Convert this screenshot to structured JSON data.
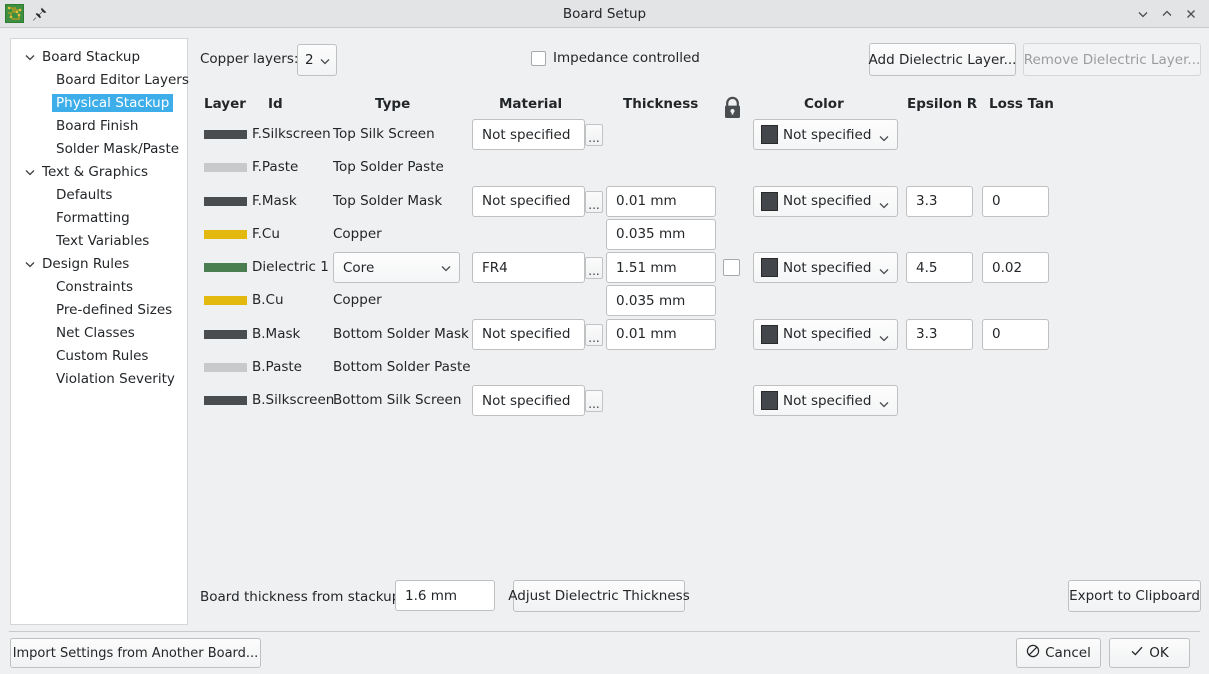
{
  "window": {
    "title": "Board Setup",
    "app_icon": "pcb-board-icon",
    "pin_icon": "pin-icon",
    "minimize_icon": "chevron-down-icon",
    "maximize_icon": "chevron-up-icon",
    "close_icon": "close-icon"
  },
  "sidebar": {
    "items": [
      {
        "label": "Board Stackup",
        "level": "group",
        "expanded": true,
        "selected": false
      },
      {
        "label": "Board Editor Layers",
        "level": "child",
        "selected": false
      },
      {
        "label": "Physical Stackup",
        "level": "child",
        "selected": true
      },
      {
        "label": "Board Finish",
        "level": "child",
        "selected": false
      },
      {
        "label": "Solder Mask/Paste",
        "level": "child",
        "selected": false
      },
      {
        "label": "Text & Graphics",
        "level": "group",
        "expanded": true,
        "selected": false
      },
      {
        "label": "Defaults",
        "level": "child",
        "selected": false
      },
      {
        "label": "Formatting",
        "level": "child",
        "selected": false
      },
      {
        "label": "Text Variables",
        "level": "child",
        "selected": false
      },
      {
        "label": "Design Rules",
        "level": "group",
        "expanded": true,
        "selected": false
      },
      {
        "label": "Constraints",
        "level": "child",
        "selected": false
      },
      {
        "label": "Pre-defined Sizes",
        "level": "child",
        "selected": false
      },
      {
        "label": "Net Classes",
        "level": "child",
        "selected": false
      },
      {
        "label": "Custom Rules",
        "level": "child",
        "selected": false
      },
      {
        "label": "Violation Severity",
        "level": "child",
        "selected": false
      }
    ],
    "selection_color": "#3daee9"
  },
  "toolbar": {
    "copper_layers_label": "Copper layers:",
    "copper_layers_value": "2",
    "impedance_label": "Impedance controlled",
    "impedance_checked": false,
    "add_dielectric_label": "Add Dielectric Layer...",
    "remove_dielectric_label": "Remove Dielectric Layer...",
    "remove_dielectric_disabled": true
  },
  "table": {
    "headers": {
      "layer": "Layer",
      "id": "Id",
      "type": "Type",
      "material": "Material",
      "thickness": "Thickness",
      "lock": "lock-icon",
      "color": "Color",
      "epsilon": "Epsilon R",
      "loss": "Loss Tan"
    },
    "not_specified": "Not specified",
    "dots_label": "...",
    "rows": [
      {
        "id": "F.Silkscreen",
        "swatch": "#4a4d50",
        "type_text": "Top Silk Screen",
        "type_select": null,
        "material": "Not specified",
        "thickness": null,
        "lock": false,
        "color": "Not specified",
        "color_chip": "#43464a",
        "epsilon": null,
        "loss": null
      },
      {
        "id": "F.Paste",
        "swatch": "#c8c9cb",
        "type_text": "Top Solder Paste",
        "type_select": null,
        "material": null,
        "thickness": null,
        "lock": false,
        "color": null,
        "color_chip": null,
        "epsilon": null,
        "loss": null
      },
      {
        "id": "F.Mask",
        "swatch": "#4a4d50",
        "type_text": "Top Solder Mask",
        "type_select": null,
        "material": "Not specified",
        "thickness": "0.01 mm",
        "lock": false,
        "color": "Not specified",
        "color_chip": "#43464a",
        "epsilon": "3.3",
        "loss": "0"
      },
      {
        "id": "F.Cu",
        "swatch": "#e3b80f",
        "type_text": "Copper",
        "type_select": null,
        "material": null,
        "thickness": "0.035 mm",
        "lock": false,
        "color": null,
        "color_chip": null,
        "epsilon": null,
        "loss": null
      },
      {
        "id": "Dielectric 1",
        "swatch": "#4a7d4f",
        "type_text": null,
        "type_select": "Core",
        "material": "FR4",
        "thickness": "1.51 mm",
        "lock": true,
        "color": "Not specified",
        "color_chip": "#43464a",
        "epsilon": "4.5",
        "loss": "0.02"
      },
      {
        "id": "B.Cu",
        "swatch": "#e3b80f",
        "type_text": "Copper",
        "type_select": null,
        "material": null,
        "thickness": "0.035 mm",
        "lock": false,
        "color": null,
        "color_chip": null,
        "epsilon": null,
        "loss": null
      },
      {
        "id": "B.Mask",
        "swatch": "#4a4d50",
        "type_text": "Bottom Solder Mask",
        "type_select": null,
        "material": "Not specified",
        "thickness": "0.01 mm",
        "lock": false,
        "color": "Not specified",
        "color_chip": "#43464a",
        "epsilon": "3.3",
        "loss": "0"
      },
      {
        "id": "B.Paste",
        "swatch": "#c8c9cb",
        "type_text": "Bottom Solder Paste",
        "type_select": null,
        "material": null,
        "thickness": null,
        "lock": false,
        "color": null,
        "color_chip": null,
        "epsilon": null,
        "loss": null
      },
      {
        "id": "B.Silkscreen",
        "swatch": "#4a4d50",
        "type_text": "Bottom Silk Screen",
        "type_select": null,
        "material": "Not specified",
        "thickness": null,
        "lock": false,
        "color": "Not specified",
        "color_chip": "#43464a",
        "epsilon": null,
        "loss": null
      }
    ]
  },
  "bottom": {
    "board_thickness_label": "Board thickness from stackup:",
    "board_thickness_value": "1.6 mm",
    "adjust_label": "Adjust Dielectric Thickness",
    "export_label": "Export to Clipboard"
  },
  "footer": {
    "import_label": "Import Settings from Another Board...",
    "cancel_label": "Cancel",
    "ok_label": "OK",
    "cancel_icon": "no-entry-icon",
    "ok_icon": "check-icon"
  }
}
